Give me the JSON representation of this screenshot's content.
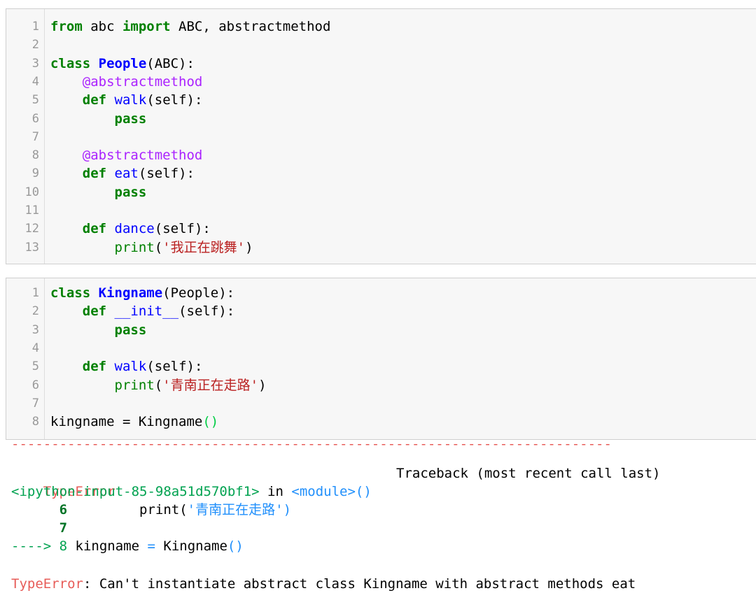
{
  "cell1": {
    "lines": [
      {
        "n": "1",
        "parts": [
          [
            "kw",
            "from"
          ],
          [
            "plain",
            " abc "
          ],
          [
            "kw",
            "import"
          ],
          [
            "plain",
            " ABC, abstractmethod"
          ]
        ]
      },
      {
        "n": "2",
        "parts": []
      },
      {
        "n": "3",
        "parts": [
          [
            "kw",
            "class"
          ],
          [
            "plain",
            " "
          ],
          [
            "cl",
            "People"
          ],
          [
            "plain",
            "(ABC):"
          ]
        ]
      },
      {
        "n": "4",
        "parts": [
          [
            "plain",
            "    "
          ],
          [
            "dec",
            "@abstractmethod"
          ]
        ]
      },
      {
        "n": "5",
        "parts": [
          [
            "plain",
            "    "
          ],
          [
            "kw",
            "def"
          ],
          [
            "plain",
            " "
          ],
          [
            "fn",
            "walk"
          ],
          [
            "plain",
            "(self):"
          ]
        ]
      },
      {
        "n": "6",
        "parts": [
          [
            "plain",
            "        "
          ],
          [
            "kw",
            "pass"
          ]
        ]
      },
      {
        "n": "7",
        "parts": []
      },
      {
        "n": "8",
        "parts": [
          [
            "plain",
            "    "
          ],
          [
            "dec",
            "@abstractmethod"
          ]
        ]
      },
      {
        "n": "9",
        "parts": [
          [
            "plain",
            "    "
          ],
          [
            "kw",
            "def"
          ],
          [
            "plain",
            " "
          ],
          [
            "fn",
            "eat"
          ],
          [
            "plain",
            "(self):"
          ]
        ]
      },
      {
        "n": "10",
        "parts": [
          [
            "plain",
            "        "
          ],
          [
            "kw",
            "pass"
          ]
        ]
      },
      {
        "n": "11",
        "parts": []
      },
      {
        "n": "12",
        "parts": [
          [
            "plain",
            "    "
          ],
          [
            "kw",
            "def"
          ],
          [
            "plain",
            " "
          ],
          [
            "fn",
            "dance"
          ],
          [
            "plain",
            "(self):"
          ]
        ]
      },
      {
        "n": "13",
        "parts": [
          [
            "plain",
            "        "
          ],
          [
            "bi",
            "print"
          ],
          [
            "plain",
            "("
          ],
          [
            "str",
            "'我正在跳舞'"
          ],
          [
            "plain",
            ")"
          ]
        ]
      }
    ]
  },
  "cell2": {
    "lines": [
      {
        "n": "1",
        "parts": [
          [
            "kw",
            "class"
          ],
          [
            "plain",
            " "
          ],
          [
            "cl",
            "Kingname"
          ],
          [
            "plain",
            "(People):"
          ]
        ]
      },
      {
        "n": "2",
        "parts": [
          [
            "plain",
            "    "
          ],
          [
            "kw",
            "def"
          ],
          [
            "plain",
            " "
          ],
          [
            "fn",
            "__init__"
          ],
          [
            "plain",
            "(self):"
          ]
        ]
      },
      {
        "n": "3",
        "parts": [
          [
            "plain",
            "        "
          ],
          [
            "kw",
            "pass"
          ]
        ]
      },
      {
        "n": "4",
        "parts": []
      },
      {
        "n": "5",
        "parts": [
          [
            "plain",
            "    "
          ],
          [
            "kw",
            "def"
          ],
          [
            "plain",
            " "
          ],
          [
            "fn",
            "walk"
          ],
          [
            "plain",
            "(self):"
          ]
        ]
      },
      {
        "n": "6",
        "parts": [
          [
            "plain",
            "        "
          ],
          [
            "bi",
            "print"
          ],
          [
            "plain",
            "("
          ],
          [
            "str",
            "'青南正在走路'"
          ],
          [
            "plain",
            ")"
          ]
        ]
      },
      {
        "n": "7",
        "parts": []
      },
      {
        "n": "8",
        "parts": [
          [
            "plain",
            "kingname = Kingname"
          ],
          [
            "paren-hl",
            "()"
          ]
        ]
      }
    ]
  },
  "output": {
    "separator": "---------------------------------------------------------------------------",
    "error_type": "TypeError",
    "traceback_header": "Traceback (most recent call last)",
    "input_ref": "<ipython-input-85-98a51d570bf1>",
    "in_word": " in ",
    "module_ref": "<module>()",
    "ctx_line6_num": "      6",
    "ctx_line6_code": "         print(",
    "ctx_line6_str": "'青南正在走路'",
    "ctx_line6_close": ")",
    "ctx_line7_num": "      7",
    "arrow": "---->",
    "arrow_num": " 8",
    "arrow_code_a": " kingname ",
    "arrow_eq": "=",
    "arrow_code_b": " Kingname",
    "arrow_paren": "()",
    "final_error_type": "TypeError",
    "final_error_msg": ": Can't instantiate abstract class Kingname with abstract methods eat"
  }
}
